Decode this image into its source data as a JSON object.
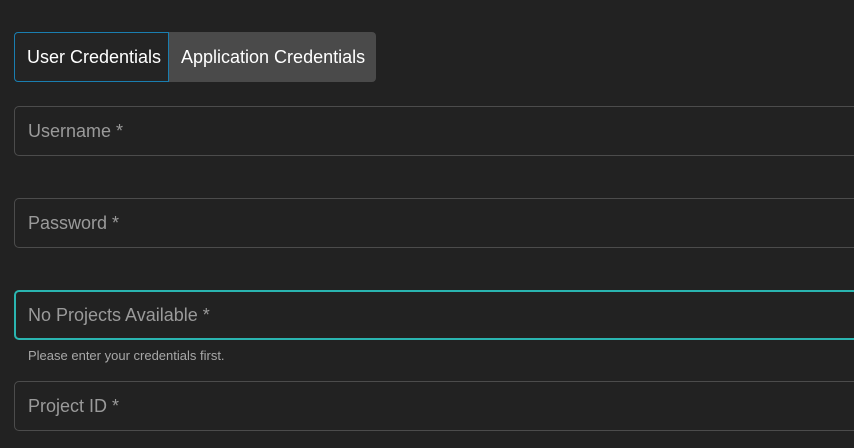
{
  "tabs": [
    {
      "label": "User Credentials",
      "active": true
    },
    {
      "label": "Application Credentials",
      "active": false
    }
  ],
  "fields": {
    "username": {
      "label": "Username *",
      "value": ""
    },
    "password": {
      "label": "Password *",
      "value": ""
    },
    "project": {
      "label": "No Projects Available *",
      "value": "",
      "helper": "Please enter your credentials first."
    },
    "project_id": {
      "label": "Project ID *",
      "value": ""
    }
  },
  "colors": {
    "background": "#222222",
    "active_tab_border": "#1a7eb0",
    "inactive_tab_bg": "#4a4a4a",
    "focus_border": "#2ab5b0",
    "field_border": "#4c4c4c",
    "placeholder_text": "#9a9a9a"
  }
}
